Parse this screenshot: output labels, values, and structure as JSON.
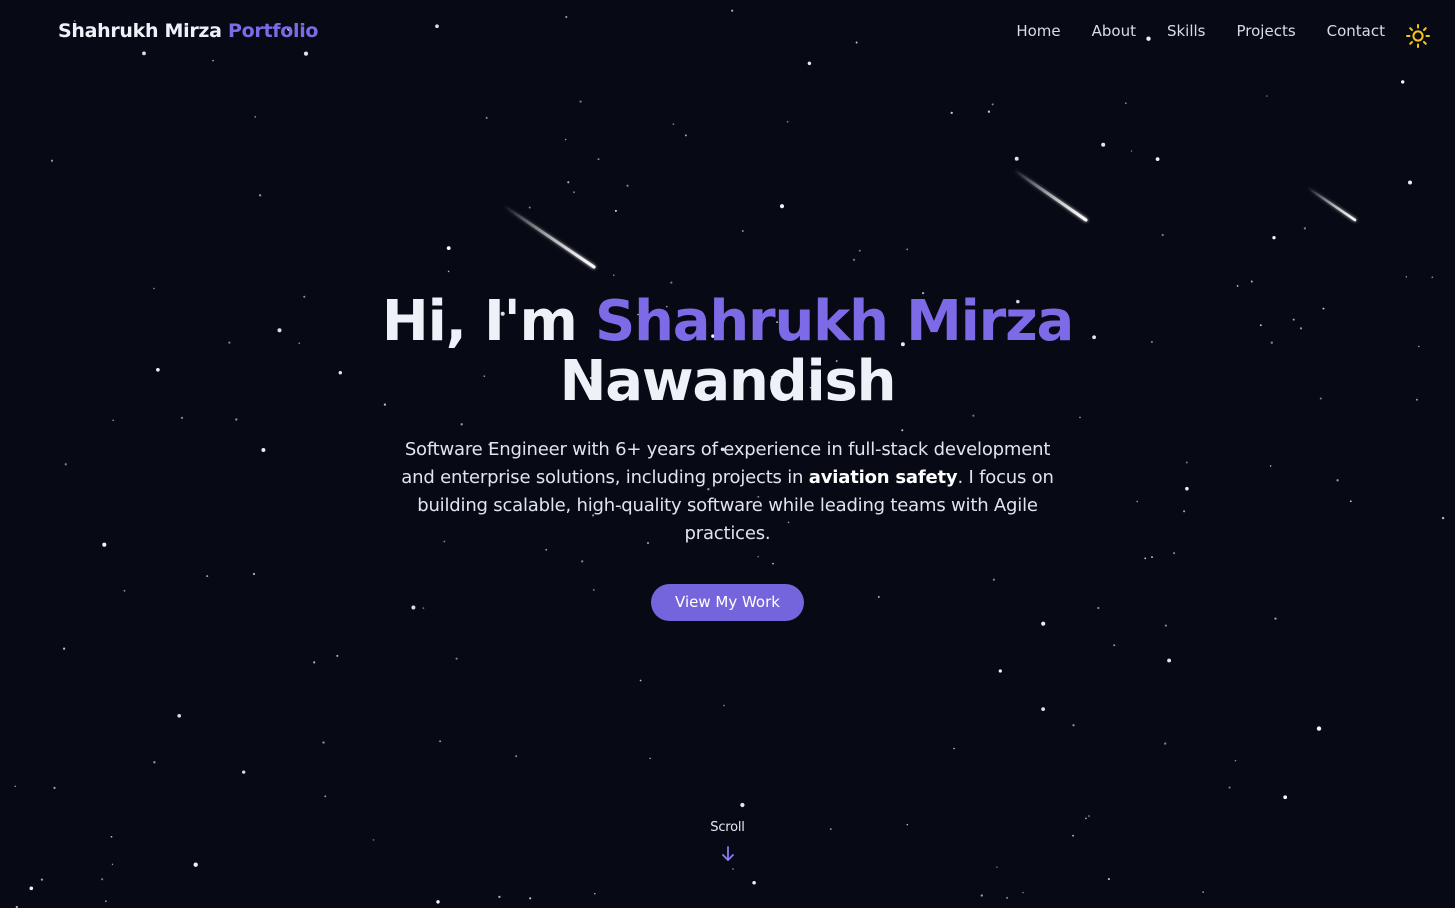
{
  "brand": {
    "name": "Shahrukh Mirza",
    "accent": "Portfolio"
  },
  "nav": {
    "items": [
      {
        "label": "Home"
      },
      {
        "label": "About"
      },
      {
        "label": "Skills"
      },
      {
        "label": "Projects"
      },
      {
        "label": "Contact"
      }
    ],
    "theme_icon": "sun-icon"
  },
  "hero": {
    "greeting": "Hi, I'm",
    "name_highlight": "Shahrukh Mirza",
    "name_rest": "Nawandish",
    "description_before": "Software Engineer with 6+ years of experience in full-stack development and enterprise solutions, including projects in",
    "description_bold": "aviation safety",
    "description_after": ". I focus on building scalable, high-quality software while leading teams with Agile practices.",
    "cta_label": "View My Work"
  },
  "scroll": {
    "label": "Scroll",
    "icon": "arrow-down-icon"
  },
  "colors": {
    "background": "#070a14",
    "accent": "#7c6ae6",
    "button": "#7565dc",
    "text": "#eef2f8",
    "sun": "#f5c518"
  }
}
